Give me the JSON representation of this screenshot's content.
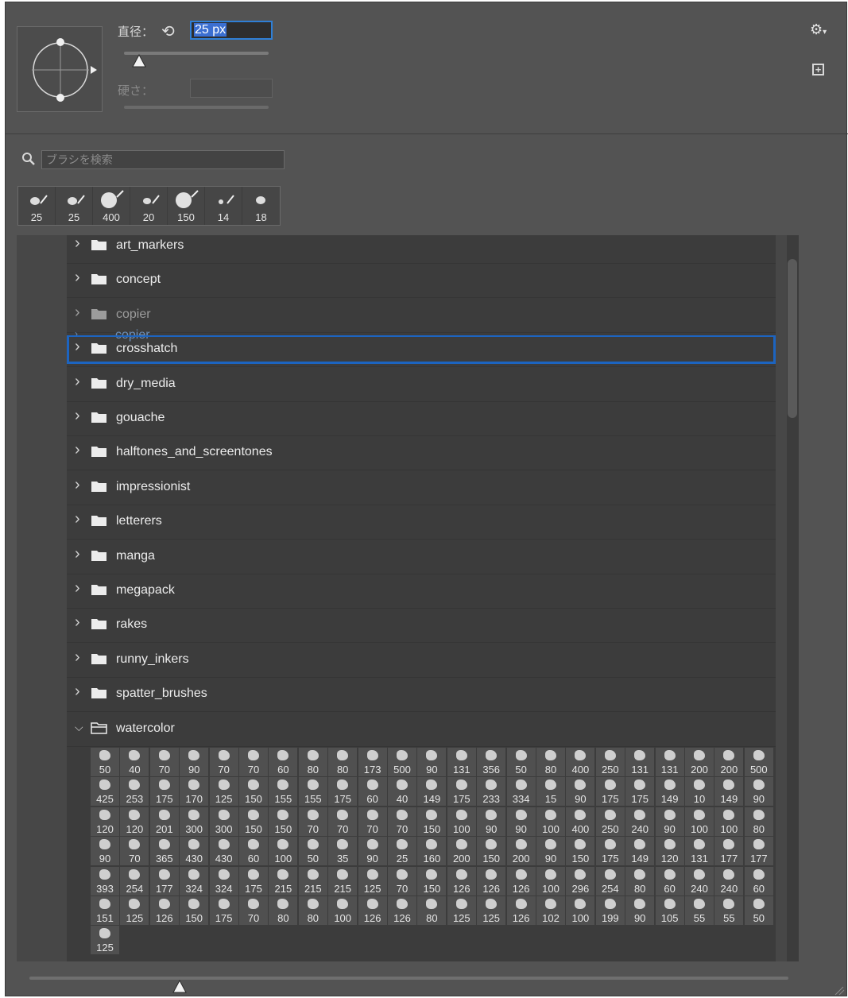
{
  "header": {
    "diameter_label": "直径：",
    "diameter_value": "25 px",
    "hardness_label": "硬さ："
  },
  "search": {
    "placeholder": "ブラシを検索"
  },
  "recent_brushes": [
    "25",
    "25",
    "400",
    "20",
    "150",
    "14",
    "18"
  ],
  "folders": [
    {
      "name": "art_markers",
      "expanded": false
    },
    {
      "name": "concept",
      "expanded": false
    },
    {
      "name": "copier",
      "expanded": false,
      "dragging": true
    },
    {
      "name": "crosshatch",
      "expanded": false,
      "drop_target": true
    },
    {
      "name": "dry_media",
      "expanded": false
    },
    {
      "name": "gouache",
      "expanded": false
    },
    {
      "name": "halftones_and_screentones",
      "expanded": false
    },
    {
      "name": "impressionist",
      "expanded": false
    },
    {
      "name": "letterers",
      "expanded": false
    },
    {
      "name": "manga",
      "expanded": false
    },
    {
      "name": "megapack",
      "expanded": false
    },
    {
      "name": "rakes",
      "expanded": false
    },
    {
      "name": "runny_inkers",
      "expanded": false
    },
    {
      "name": "spatter_brushes",
      "expanded": false
    },
    {
      "name": "watercolor",
      "expanded": true
    }
  ],
  "drag_ghost_label": "copier",
  "watercolor_brushes": [
    [
      "50",
      "40",
      "70",
      "90",
      "70",
      "70",
      "60",
      "80",
      "80",
      "173",
      "500",
      "90",
      "131",
      "356",
      "50",
      "80",
      "400",
      "250",
      "131",
      "131",
      "200",
      "200",
      "500"
    ],
    [
      "425",
      "253",
      "175",
      "170",
      "125",
      "150",
      "155",
      "155",
      "175",
      "60",
      "40",
      "149",
      "175",
      "233",
      "334",
      "15",
      "90",
      "175",
      "175",
      "149",
      "10",
      "149",
      "90"
    ],
    [
      "120",
      "120",
      "201",
      "300",
      "300",
      "150",
      "150",
      "70",
      "70",
      "70",
      "70",
      "150",
      "100",
      "90",
      "90",
      "100",
      "400",
      "250",
      "240",
      "90",
      "100",
      "100",
      "80"
    ],
    [
      "90",
      "70",
      "365",
      "430",
      "430",
      "60",
      "100",
      "50",
      "35",
      "90",
      "25",
      "160",
      "200",
      "150",
      "200",
      "90",
      "150",
      "175",
      "149",
      "120",
      "131",
      "177",
      "177"
    ],
    [
      "393",
      "254",
      "177",
      "324",
      "324",
      "175",
      "215",
      "215",
      "215",
      "125",
      "70",
      "150",
      "126",
      "126",
      "126",
      "100",
      "296",
      "254",
      "80",
      "60",
      "240",
      "240",
      "60"
    ],
    [
      "151",
      "125",
      "126",
      "150",
      "175",
      "70",
      "80",
      "80",
      "100",
      "126",
      "126",
      "80",
      "125",
      "125",
      "126",
      "102",
      "100",
      "199",
      "90",
      "105",
      "55",
      "55",
      "50"
    ],
    [
      "125"
    ]
  ],
  "colors": {
    "panel": "#535353",
    "selection": "#2f7fd6"
  }
}
